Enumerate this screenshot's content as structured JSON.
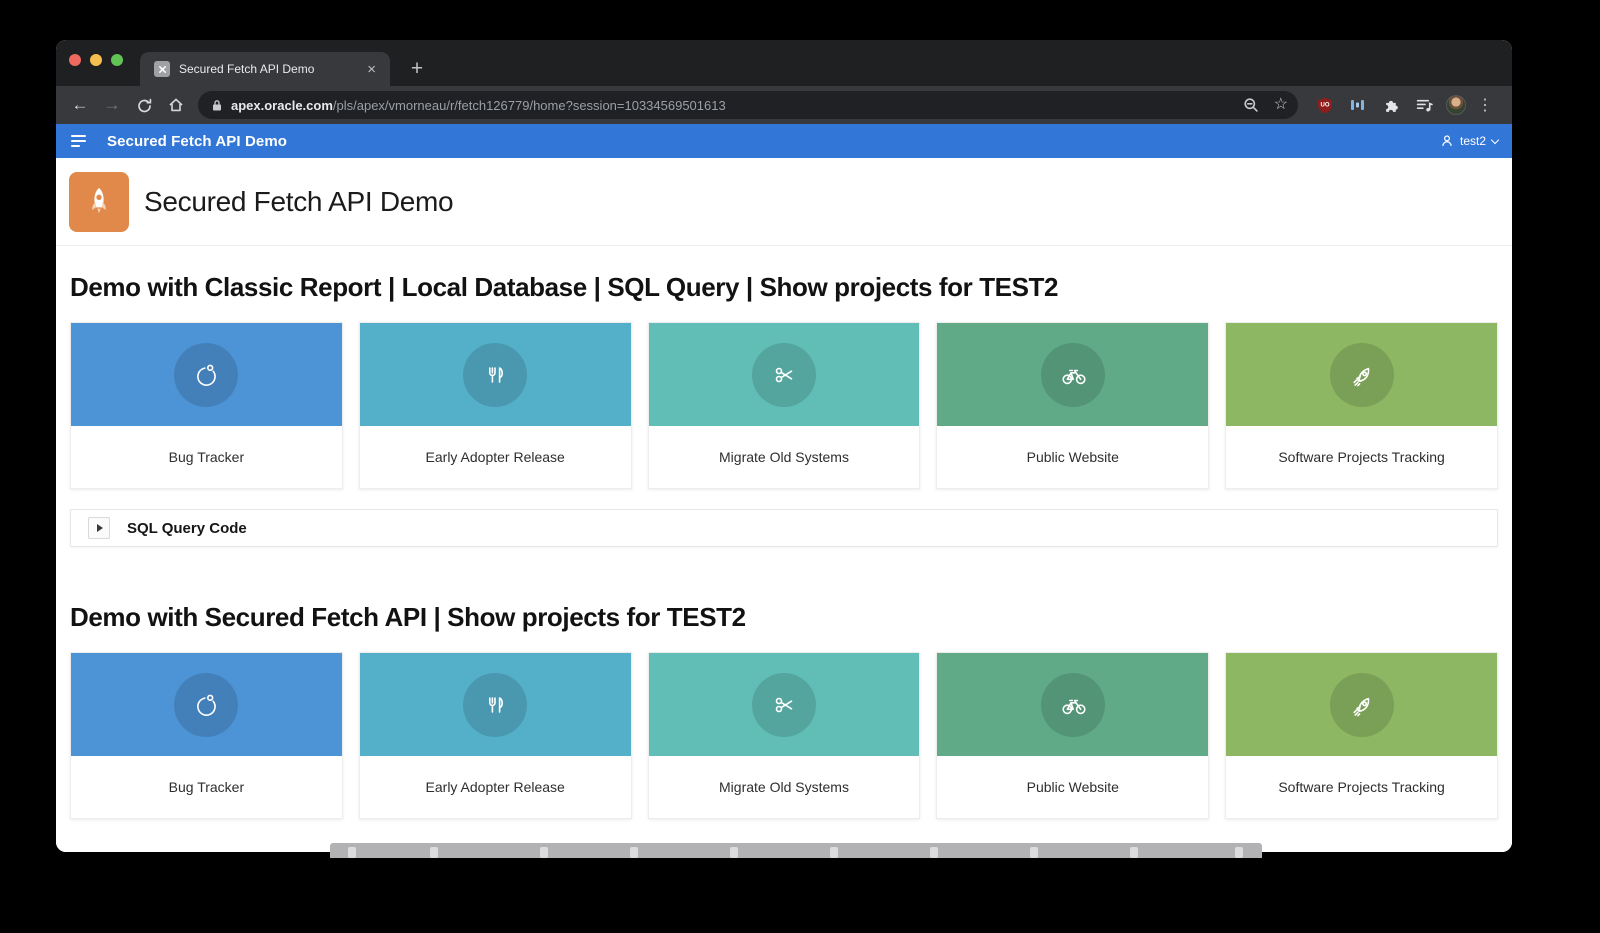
{
  "browser": {
    "tab_title": "Secured Fetch API Demo",
    "url_domain": "apex.oracle.com",
    "url_path": "/pls/apex/vmorneau/r/fetch126779/home?session=10334569501613"
  },
  "app_header": {
    "title": "Secured Fetch API Demo",
    "user_label": "test2"
  },
  "hero": {
    "app_title": "Secured Fetch API Demo"
  },
  "sections": [
    {
      "heading": "Demo with Classic Report | Local Database | SQL Query | Show projects for TEST2",
      "collapsible_label": "SQL Query Code",
      "cards": [
        {
          "label": "Bug Tracker",
          "color": "#4D94D6",
          "icon": "stopwatch"
        },
        {
          "label": "Early Adopter Release",
          "color": "#54AFC9",
          "icon": "utensils"
        },
        {
          "label": "Migrate Old Systems",
          "color": "#61BEB6",
          "icon": "scissors"
        },
        {
          "label": "Public Website",
          "color": "#60AA88",
          "icon": "bicycle"
        },
        {
          "label": "Software Projects Tracking",
          "color": "#8DB763",
          "icon": "rocket"
        }
      ]
    },
    {
      "heading": "Demo with Secured Fetch API | Show projects for TEST2",
      "cards": [
        {
          "label": "Bug Tracker",
          "color": "#4D94D6",
          "icon": "stopwatch"
        },
        {
          "label": "Early Adopter Release",
          "color": "#54AFC9",
          "icon": "utensils"
        },
        {
          "label": "Migrate Old Systems",
          "color": "#61BEB6",
          "icon": "scissors"
        },
        {
          "label": "Public Website",
          "color": "#60AA88",
          "icon": "bicycle"
        },
        {
          "label": "Software Projects Tracking",
          "color": "#8DB763",
          "icon": "rocket"
        }
      ]
    }
  ],
  "colors": {
    "accent_blue": "#3276D8",
    "logo_orange": "#E0894A",
    "traffic_close": "#EE6A5F",
    "traffic_minimize": "#F5BF4F",
    "traffic_zoom": "#61C454"
  }
}
